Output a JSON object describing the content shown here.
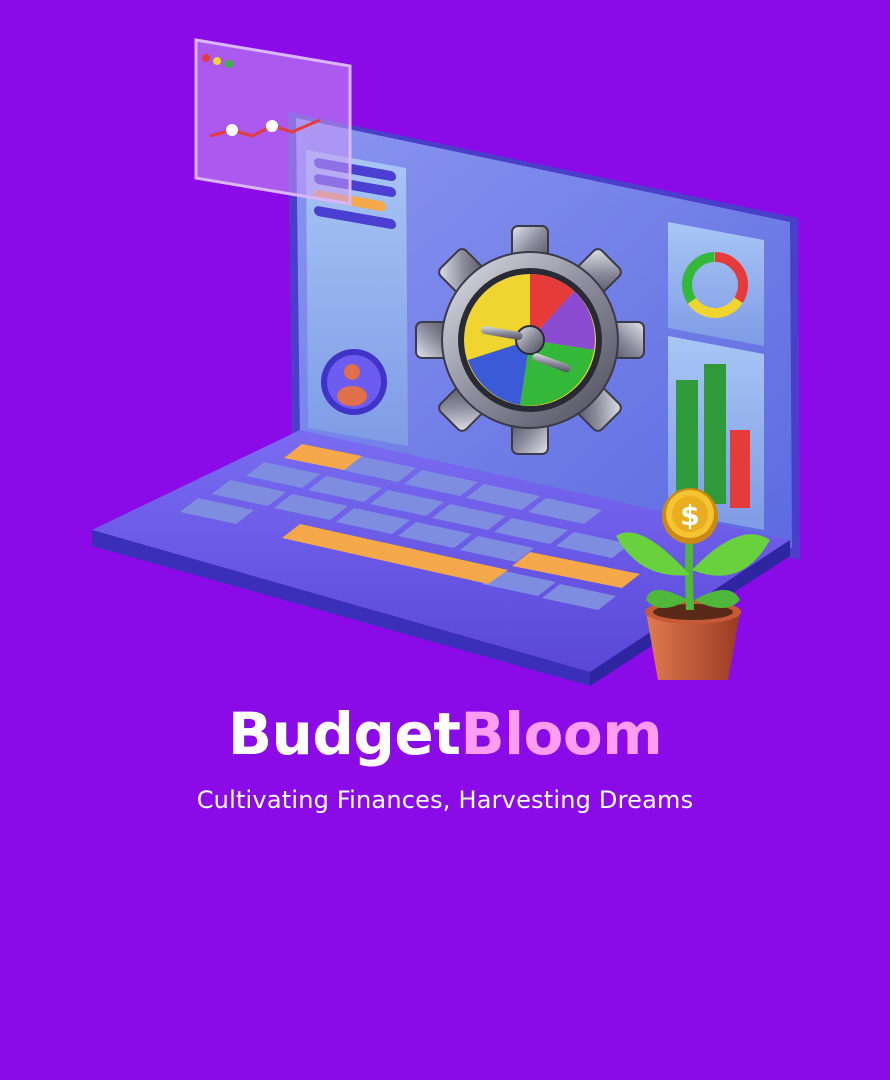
{
  "brand": {
    "name_part1": "Budget",
    "name_part2": "Bloom",
    "tagline": "Cultivating Finances, Harvesting Dreams"
  },
  "colors": {
    "background": "#8b0be8",
    "brand_text": "#ffffff",
    "brand_accent": "#ff9cf3",
    "laptop": "#6a5ee8",
    "key": "#7f8de0",
    "key_accent": "#f4a84a"
  },
  "illustration": {
    "icons": [
      "laptop-icon",
      "gear-pie-chart-icon",
      "donut-chart-icon",
      "bar-chart-icon",
      "user-avatar-icon",
      "line-chart-icon",
      "money-plant-icon",
      "dollar-coin-icon"
    ],
    "currency_symbol": "$"
  }
}
